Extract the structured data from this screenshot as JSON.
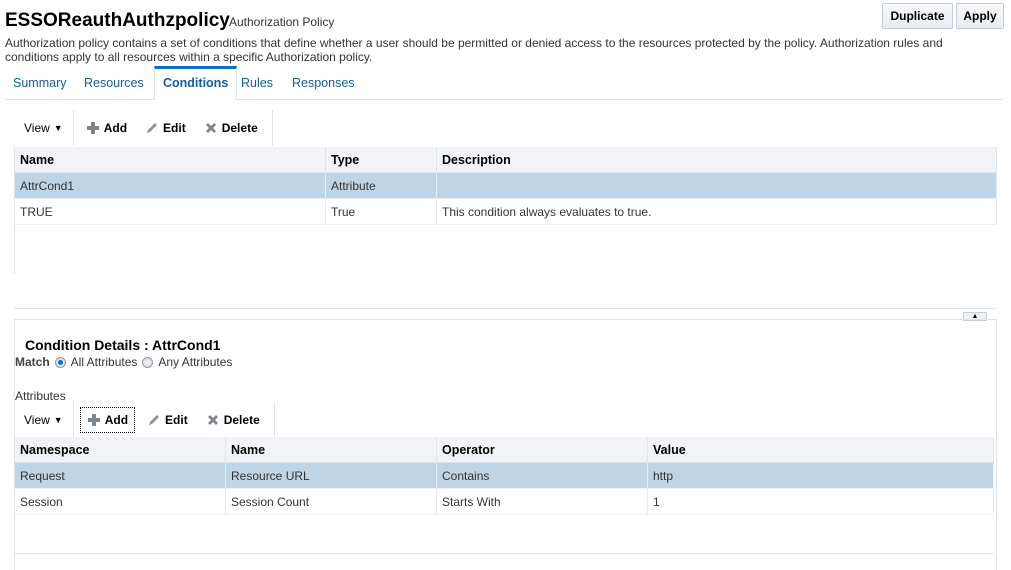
{
  "header": {
    "title": "ESSOReauthAuthzpolicy",
    "subtitle": "Authorization Policy",
    "description": "Authorization policy contains a set of conditions that define whether a user should be permitted or denied access to the resources protected by the policy. Authorization rules and conditions apply to all resources within a specific Authorization policy.",
    "duplicate_label": "Duplicate",
    "apply_label": "Apply"
  },
  "tabs": [
    {
      "label": "Summary",
      "active": false
    },
    {
      "label": "Resources",
      "active": false
    },
    {
      "label": "Conditions",
      "active": true
    },
    {
      "label": "Rules",
      "active": false
    },
    {
      "label": "Responses",
      "active": false
    }
  ],
  "conditions_toolbar": {
    "view_label": "View",
    "add_label": "Add",
    "edit_label": "Edit",
    "delete_label": "Delete"
  },
  "conditions_table": {
    "columns": [
      "Name",
      "Type",
      "Description"
    ],
    "rows": [
      {
        "name": "AttrCond1",
        "type": "Attribute",
        "description": "",
        "selected": true
      },
      {
        "name": "TRUE",
        "type": "True",
        "description": "This condition always evaluates to true.",
        "selected": false
      }
    ]
  },
  "details": {
    "title": "Condition Details : AttrCond1",
    "match_label": "Match",
    "match_options": [
      {
        "label": "All Attributes",
        "selected": true
      },
      {
        "label": "Any Attributes",
        "selected": false
      }
    ],
    "attributes_label": "Attributes",
    "toolbar": {
      "view_label": "View",
      "add_label": "Add",
      "edit_label": "Edit",
      "delete_label": "Delete"
    },
    "table": {
      "columns": [
        "Namespace",
        "Name",
        "Operator",
        "Value"
      ],
      "rows": [
        {
          "namespace": "Request",
          "name": "Resource URL",
          "operator": "Contains",
          "value": "http",
          "selected": true
        },
        {
          "namespace": "Session",
          "name": "Session Count",
          "operator": "Starts With",
          "value": "1",
          "selected": false
        }
      ]
    }
  }
}
